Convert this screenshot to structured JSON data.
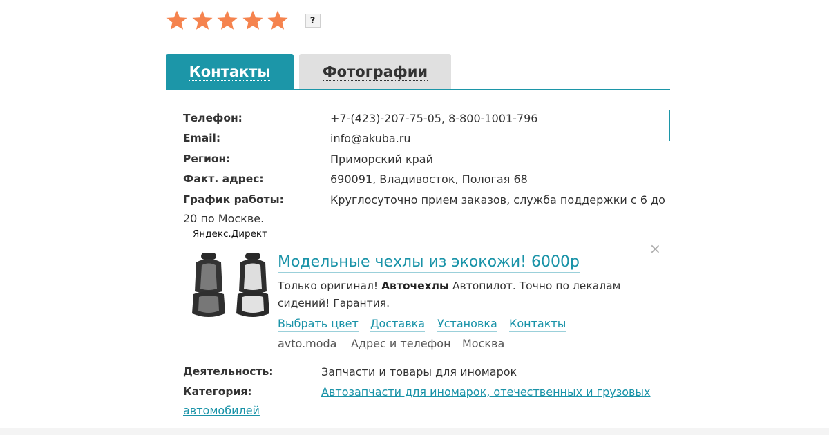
{
  "rating": {
    "value": 5,
    "max": 5,
    "star_color": "#f5834e",
    "help_label": "?"
  },
  "tabs": [
    {
      "label": "Контакты",
      "active": true
    },
    {
      "label": "Фотографии",
      "active": false
    }
  ],
  "accent_color": "#1c96a8",
  "contacts": {
    "phone_label": "Телефон:",
    "phone_value": "+7-(423)-207-75-05, 8-800-1001-796",
    "email_label": "Email:",
    "email_value": "info@akuba.ru",
    "region_label": "Регион:",
    "region_value": "Приморский край",
    "address_label": "Факт. адрес:",
    "address_value": "690091, Владивосток, Пологая 68",
    "schedule_label": "График работы:",
    "schedule_value": "Круглосуточно прием заказов, служба поддержки с 6 до",
    "schedule_value_cont": "20 по Москве."
  },
  "ad": {
    "source": "Яндекс.Директ",
    "close_icon": "×",
    "title": "Модельные чехлы из экокожи! 6000р",
    "desc_before": "Только оригинал! ",
    "desc_bold": "Авточехлы",
    "desc_after": " Автопилот. Точно по лекалам сидений! Гарантия.",
    "links": [
      "Выбрать цвет",
      "Доставка",
      "Установка",
      "Контакты"
    ],
    "meta": [
      "avto.moda",
      "Адрес и телефон",
      "Москва"
    ]
  },
  "details": {
    "activity_label": "Деятельность:",
    "activity_value": "Запчасти и товары для иномарок",
    "category_label": "Категория:",
    "category_link": "Автозапчасти для иномарок, отечественных и грузовых",
    "category_link_cont": "автомобилей"
  }
}
